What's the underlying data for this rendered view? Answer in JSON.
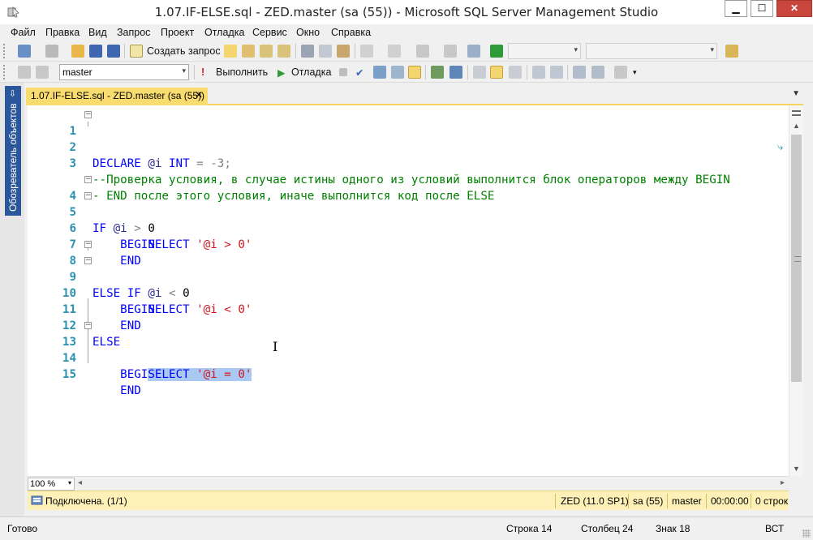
{
  "window": {
    "title": "1.07.IF-ELSE.sql - ZED.master (sa (55)) - Microsoft SQL Server Management Studio",
    "minimize": "▁",
    "maximize": "☐",
    "close": "✕"
  },
  "menu": [
    "Файл",
    "Правка",
    "Вид",
    "Запрос",
    "Проект",
    "Отладка",
    "Сервис",
    "Окно",
    "Справка"
  ],
  "toolbar1": {
    "new_query_label": "Создать запрос",
    "empty_combo_1": "",
    "empty_combo_2": ""
  },
  "toolbar2": {
    "database_value": "master",
    "execute_label": "Выполнить",
    "debug_label": "Отладка"
  },
  "left_panel": {
    "label": "Обозреватель объектов",
    "pin": "⇩"
  },
  "document_tab": {
    "label": "1.07.IF-ELSE.sql - ZED.master (sa (55))",
    "close": "✕"
  },
  "editor": {
    "line_numbers": [
      "1",
      "2",
      "3",
      "",
      "4",
      "5",
      "6",
      "7",
      "8",
      "9",
      "10",
      "11",
      "12",
      "13",
      "14",
      "15"
    ],
    "l1_kw": "DECLARE",
    "l1_var": "@i",
    "l1_type": "INT",
    "l1_eq": "=",
    "l1_val": "-3;",
    "l3_comment": "--Проверка условия, в случае истины одного из условий выполнится блок операторов между BEGIN",
    "l3b_comment": "- END после этого условия, иначе выполнится код после ELSE",
    "l4_if": "IF",
    "l4_var": "@i",
    "l4_op": ">",
    "l4_val": "0",
    "begin": "BEGIN",
    "end": "END",
    "select": "SELECT",
    "l6_str": "'@i > 0'",
    "l8_else": "ELSE",
    "l8_if": "IF",
    "l8_var": "@i",
    "l8_op": "<",
    "l8_val": "0",
    "l10_str": "'@i < 0'",
    "l12_else": "ELSE",
    "l14_str": "'@i = 0'",
    "wrap_glyph": "⤷"
  },
  "zoom": "100 %",
  "query_status": {
    "message": "Подключена. (1/1)",
    "server": "ZED (11.0 SP1)",
    "login": "sa (55)",
    "database": "master",
    "elapsed": "00:00:00",
    "rows": "0 строк"
  },
  "status_bar": {
    "ready": "Готово",
    "line": "Строка 14",
    "column": "Столбец 24",
    "char": "Знак 18",
    "mode": "ВСТ"
  },
  "colors": {
    "keyword": "#0000ff",
    "string": "#d2151e",
    "comment": "#008000",
    "line_number": "#2b91af",
    "tab_active": "#f9dc6f",
    "query_status_bg": "#fdf1b7",
    "selection": "#a9c9f2"
  }
}
